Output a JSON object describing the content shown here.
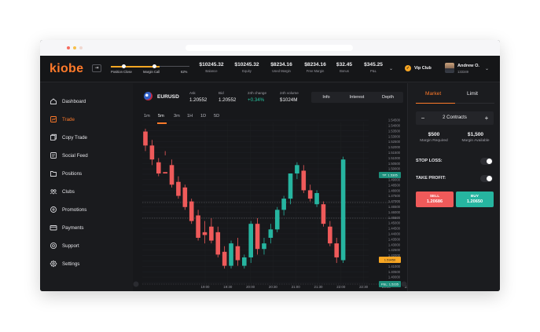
{
  "app": {
    "logo": "kiobe"
  },
  "colors": {
    "accent": "#ff7a2a",
    "gold": "#f7a623",
    "up": "#26b5a0",
    "down": "#ef5a5a",
    "background": "#1a1b1e"
  },
  "margin_slider": {
    "position_close_label": "Position Close",
    "margin_call_label": "Margin Call",
    "percent_label": "62%",
    "level": 0.62
  },
  "account": [
    {
      "value": "$10245.32",
      "label": "Balance"
    },
    {
      "value": "$10245.32",
      "label": "Equity"
    },
    {
      "value": "$8234.16",
      "label": "Used Margin"
    },
    {
      "value": "$8234.16",
      "label": "Free Margin"
    },
    {
      "value": "$32.45",
      "label": "Bonus"
    },
    {
      "value": "$345.25",
      "label": "P&L"
    }
  ],
  "vip": {
    "label": "Vip Club"
  },
  "user": {
    "name": "Andrew O.",
    "id": "133349"
  },
  "sidebar": {
    "items": [
      {
        "label": "Dashboard",
        "icon": "home-icon"
      },
      {
        "label": "Trade",
        "icon": "trade-icon"
      },
      {
        "label": "Copy Trade",
        "icon": "copy-icon"
      },
      {
        "label": "Social Feed",
        "icon": "feed-icon"
      },
      {
        "label": "Positions",
        "icon": "positions-icon"
      },
      {
        "label": "Clubs",
        "icon": "clubs-icon"
      },
      {
        "label": "Promotions",
        "icon": "promotions-icon"
      },
      {
        "label": "Payments",
        "icon": "card-icon"
      },
      {
        "label": "Support",
        "icon": "support-icon"
      },
      {
        "label": "Settings",
        "icon": "gear-icon"
      }
    ],
    "active_index": 1
  },
  "instrument": {
    "pair": "EURUSD",
    "ask_label": "Ask",
    "ask": "1.20552",
    "bid_label": "Bid",
    "bid": "1.20552",
    "change_label": "24h change",
    "change": "+0.34%",
    "volume_label": "24h volume",
    "volume": "$1024M"
  },
  "chart_tabs": [
    "Info",
    "Interest",
    "Depth"
  ],
  "timeframes": [
    "1m",
    "5m",
    "3m",
    "1H",
    "1D",
    "5D"
  ],
  "active_timeframe": 1,
  "chart_data": {
    "type": "candlestick",
    "price_ticks": [
      "1.54500",
      "1.54000",
      "1.53500",
      "1.53000",
      "1.52500",
      "1.52000",
      "1.51500",
      "1.51000",
      "1.50500",
      "1.50000",
      "1.49500",
      "1.49000",
      "1.48500",
      "1.48000",
      "1.47500",
      "1.47000",
      "1.46500",
      "1.46000",
      "1.45500",
      "1.45000",
      "1.44500",
      "1.44000",
      "1.43500",
      "1.43000",
      "1.42500",
      "1.42000",
      "1.41500",
      "1.41000",
      "1.40500",
      "1.40000",
      "1.49500"
    ],
    "time_ticks": [
      "19:00",
      "19:30",
      "20:00",
      "20:30",
      "21:00",
      "21:30",
      "22:00",
      "22:30",
      "23:00",
      "23:30"
    ],
    "ylim": [
      1.49,
      1.545
    ],
    "grid": true,
    "labels": {
      "tp": "TP: 1.5305",
      "pl": "P&L: 1.5235",
      "sl": "SL: 1.4955",
      "current": "1.53450",
      "dotted": "1.53500",
      "low": "1.49500"
    },
    "candles": [
      [
        1.544,
        1.545,
        1.539,
        1.537
      ],
      [
        1.539,
        1.541,
        1.534,
        1.532
      ],
      [
        1.533,
        1.5345,
        1.529,
        1.528
      ],
      [
        1.5295,
        1.5355,
        1.529,
        1.537
      ],
      [
        1.532,
        1.534,
        1.525,
        1.524
      ],
      [
        1.526,
        1.528,
        1.521,
        1.52
      ],
      [
        1.524,
        1.525,
        1.517,
        1.516
      ],
      [
        1.519,
        1.52,
        1.512,
        1.511
      ],
      [
        1.514,
        1.516,
        1.506,
        1.505
      ],
      [
        1.508,
        1.512,
        1.507,
        1.504
      ],
      [
        1.51,
        1.513,
        1.505,
        1.504
      ],
      [
        1.508,
        1.51,
        1.5,
        1.499
      ],
      [
        1.501,
        1.503,
        1.496,
        1.495
      ],
      [
        1.496,
        1.505,
        1.504,
        1.495
      ],
      [
        1.503,
        1.506,
        1.498,
        1.496
      ],
      [
        1.496,
        1.5,
        1.499,
        1.495
      ],
      [
        1.499,
        1.512,
        1.511,
        1.497
      ],
      [
        1.511,
        1.513,
        1.502,
        1.5
      ],
      [
        1.502,
        1.506,
        1.504,
        1.5
      ],
      [
        1.506,
        1.511,
        1.509,
        1.504
      ],
      [
        1.509,
        1.517,
        1.516,
        1.508
      ],
      [
        1.516,
        1.521,
        1.52,
        1.514
      ],
      [
        1.52,
        1.529,
        1.529,
        1.518
      ],
      [
        1.529,
        1.533,
        1.532,
        1.527
      ],
      [
        1.53,
        1.532,
        1.523,
        1.522
      ],
      [
        1.523,
        1.525,
        1.52,
        1.519
      ],
      [
        1.518,
        1.523,
        1.522,
        1.517
      ],
      [
        1.518,
        1.519,
        1.511,
        1.51
      ],
      [
        1.51,
        1.512,
        1.504,
        1.503
      ],
      [
        1.504,
        1.506,
        1.499,
        1.497
      ],
      [
        1.498,
        1.535,
        1.534,
        1.497
      ]
    ]
  },
  "order": {
    "tabs": [
      "Market",
      "Limit"
    ],
    "quantity": "2 Contracts",
    "minus": "−",
    "plus": "+",
    "margin_required": "$500",
    "margin_required_label": "Margin Required",
    "margin_available": "$1,500",
    "margin_available_label": "Margin Available",
    "stop_loss_label": "STOP LOSS:",
    "take_profit_label": "TAKE PROFIT:",
    "sell_label": "SELL",
    "sell_price": "1.20686",
    "buy_label": "BUY",
    "buy_price": "1.20650"
  }
}
